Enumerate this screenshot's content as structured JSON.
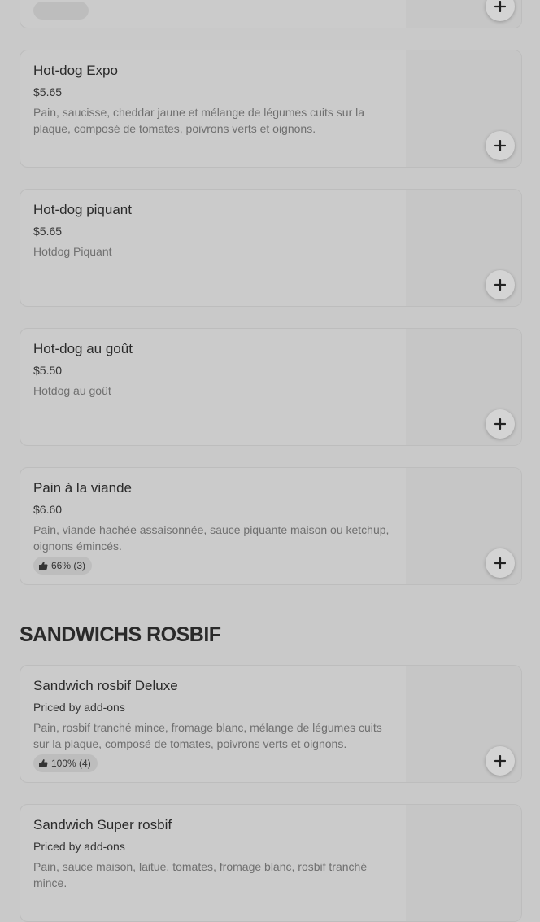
{
  "sections": [
    {
      "title": "",
      "items": [
        {
          "name": "",
          "price": "",
          "description": "",
          "rating": ""
        },
        {
          "name": "Hot-dog Expo",
          "price": "$5.65",
          "description": "Pain, saucisse, cheddar jaune et mélange de légumes cuits sur la plaque, composé de tomates, poivrons verts et oignons.",
          "rating": ""
        },
        {
          "name": "Hot-dog piquant",
          "price": "$5.65",
          "description": "Hotdog Piquant",
          "rating": ""
        },
        {
          "name": "Hot-dog au goût",
          "price": "$5.50",
          "description": "Hotdog au goût",
          "rating": ""
        },
        {
          "name": "Pain à la viande",
          "price": "$6.60",
          "description": "Pain, viande hachée assaisonnée, sauce piquante maison ou ketchup, oignons émincés.",
          "rating": "66% (3)"
        }
      ]
    },
    {
      "title": "SANDWICHS ROSBIF",
      "items": [
        {
          "name": "Sandwich rosbif Deluxe",
          "price": "Priced by add-ons",
          "description": "Pain, rosbif tranché mince, fromage blanc, mélange de légumes cuits sur la plaque, composé de tomates, poivrons verts et oignons.",
          "rating": "100% (4)"
        },
        {
          "name": "Sandwich Super rosbif",
          "price": "Priced by add-ons",
          "description": "Pain, sauce maison, laitue, tomates, fromage blanc, rosbif tranché mince.",
          "rating": ""
        }
      ]
    }
  ],
  "icons": {
    "add": "plus-icon",
    "rating": "thumbs-up-icon"
  },
  "colors": {
    "background": "#c9c9c9",
    "card": "#cbcbcb",
    "text": "#2a2a2a",
    "muted": "#6f6f6f"
  }
}
